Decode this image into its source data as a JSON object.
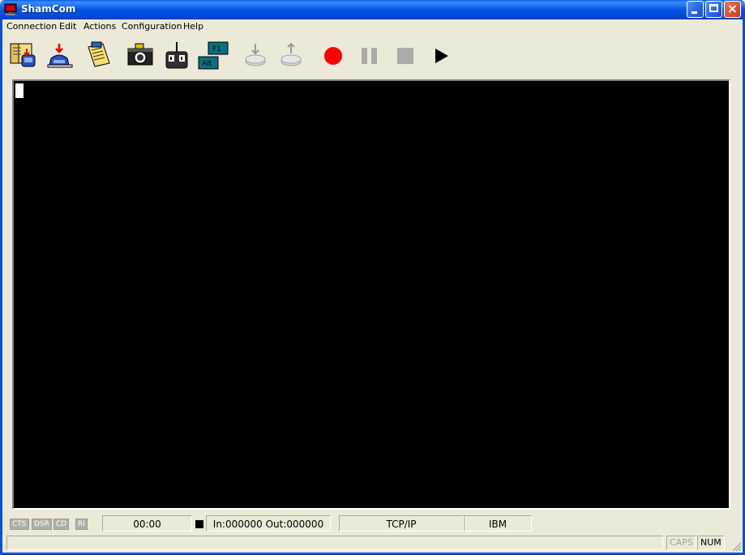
{
  "window": {
    "title": "ShamCom"
  },
  "menu": {
    "items": [
      {
        "label": "Connection"
      },
      {
        "label": "Edit"
      },
      {
        "label": "Actions"
      },
      {
        "label": "Configuration"
      },
      {
        "label": "Help"
      }
    ]
  },
  "toolbar": {
    "buttons": [
      {
        "icon": "phonebook-icon",
        "enabled": true
      },
      {
        "icon": "connect-phone-icon",
        "enabled": true
      },
      {
        "icon": "script-icon",
        "enabled": true
      },
      {
        "icon": "camera-icon",
        "enabled": true
      },
      {
        "icon": "serial-port-icon",
        "enabled": true
      },
      {
        "icon": "function-keys-icon",
        "labels": [
          "F1",
          "Alt"
        ],
        "enabled": true
      },
      {
        "icon": "download-icon",
        "enabled": false
      },
      {
        "icon": "upload-icon",
        "enabled": false
      },
      {
        "icon": "record-icon",
        "enabled": true
      },
      {
        "icon": "pause-icon",
        "enabled": false
      },
      {
        "icon": "stop-icon",
        "enabled": false
      },
      {
        "icon": "play-icon",
        "enabled": true
      }
    ]
  },
  "status": {
    "indicators": [
      "CTS",
      "DSR",
      "CD",
      "RI"
    ],
    "timer": "00:00",
    "counters": "In:000000 Out:000000",
    "protocol": "TCP/IP",
    "emulation": "IBM",
    "caps": "CAPS",
    "num": "NUM"
  },
  "colors": {
    "titlebar": "#0055e5",
    "terminal_bg": "#000000",
    "record": "#ff0000",
    "window_bg": "#ece9d8"
  }
}
